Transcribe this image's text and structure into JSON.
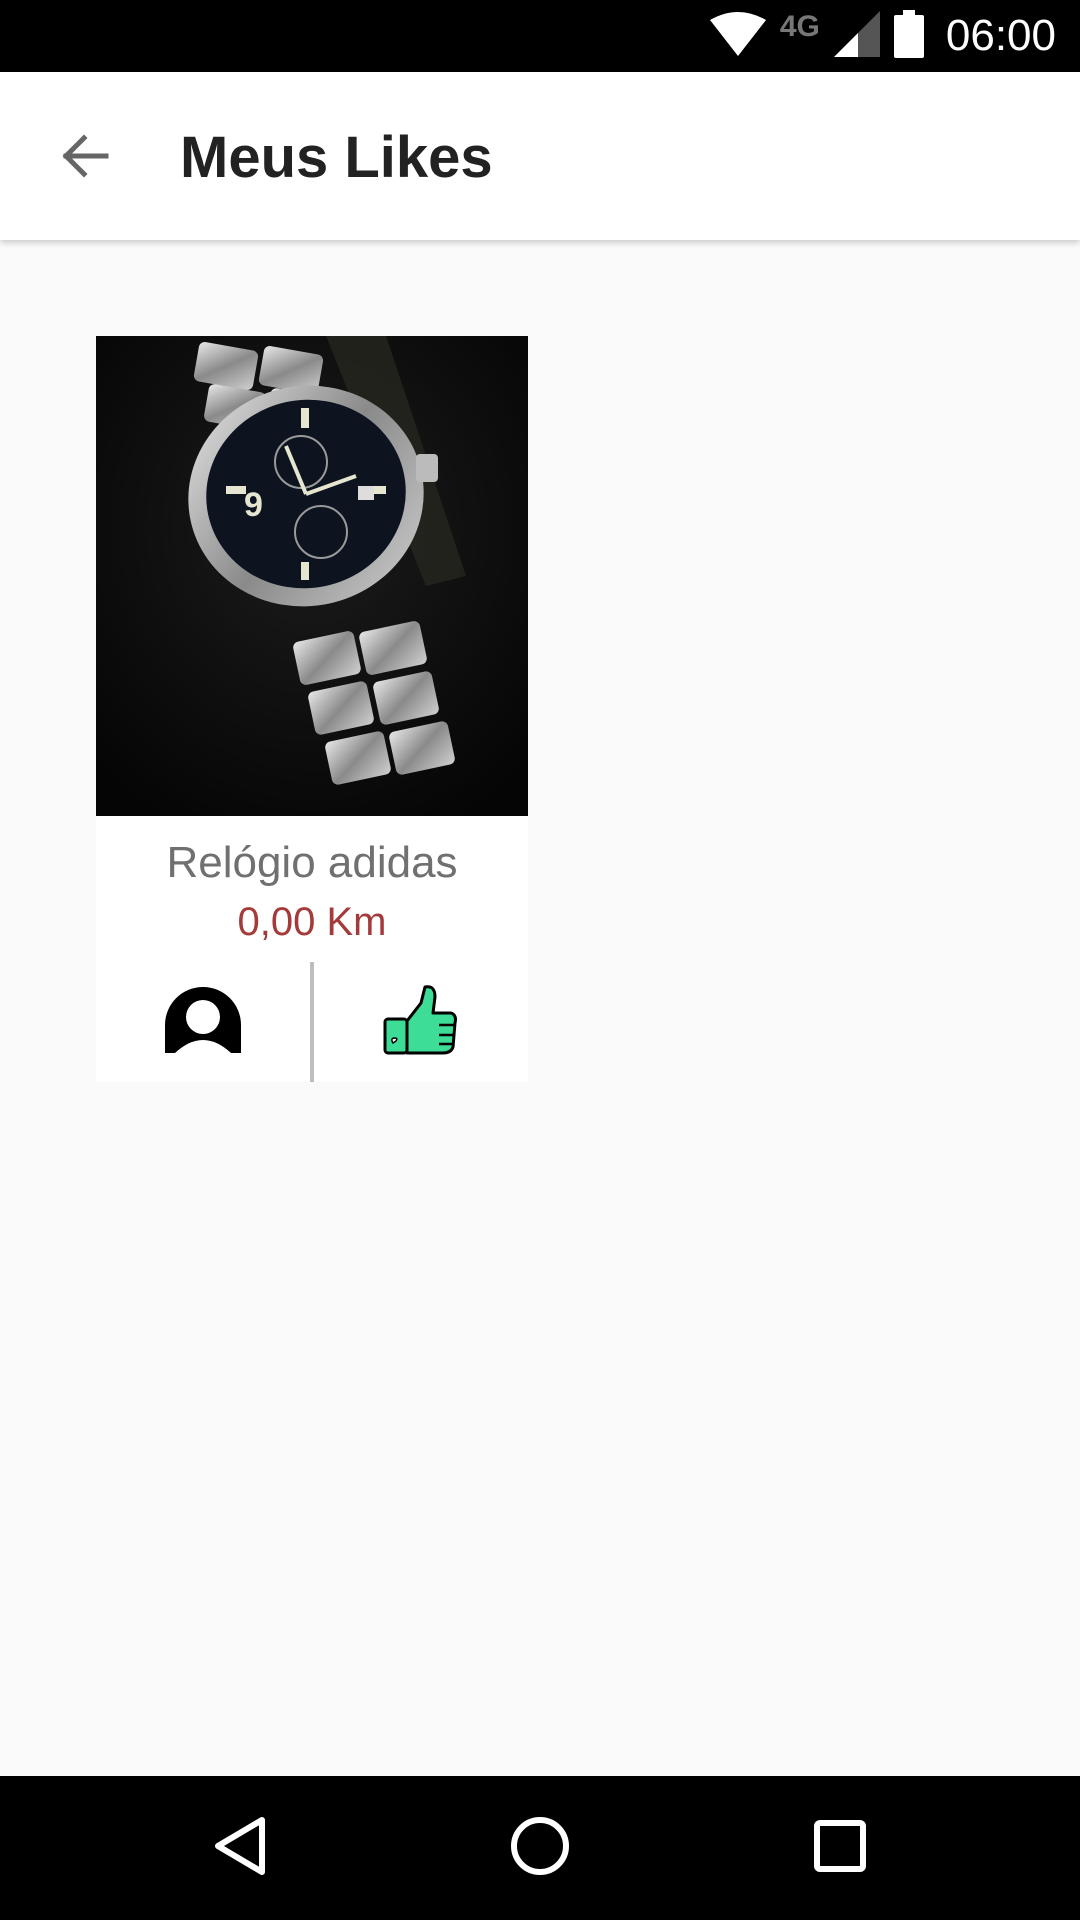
{
  "status_bar": {
    "network": "4G",
    "time": "06:00",
    "icons": [
      "wifi-icon",
      "signal-icon",
      "battery-icon"
    ]
  },
  "app_bar": {
    "title": "Meus Likes",
    "back_icon": "arrow-left-icon"
  },
  "items": [
    {
      "title": "Relógio adidas",
      "distance": "0,00 Km",
      "image": "wristwatch-photo",
      "actions": [
        "user-profile-icon",
        "thumbs-up-icon"
      ]
    }
  ],
  "nav_bar": {
    "buttons": [
      "back-triangle-icon",
      "home-circle-icon",
      "recents-square-icon"
    ]
  },
  "colors": {
    "background": "#fafafa",
    "distance": "#a43a3a",
    "title_gray": "#707070",
    "like_green": "#3ddc97"
  }
}
